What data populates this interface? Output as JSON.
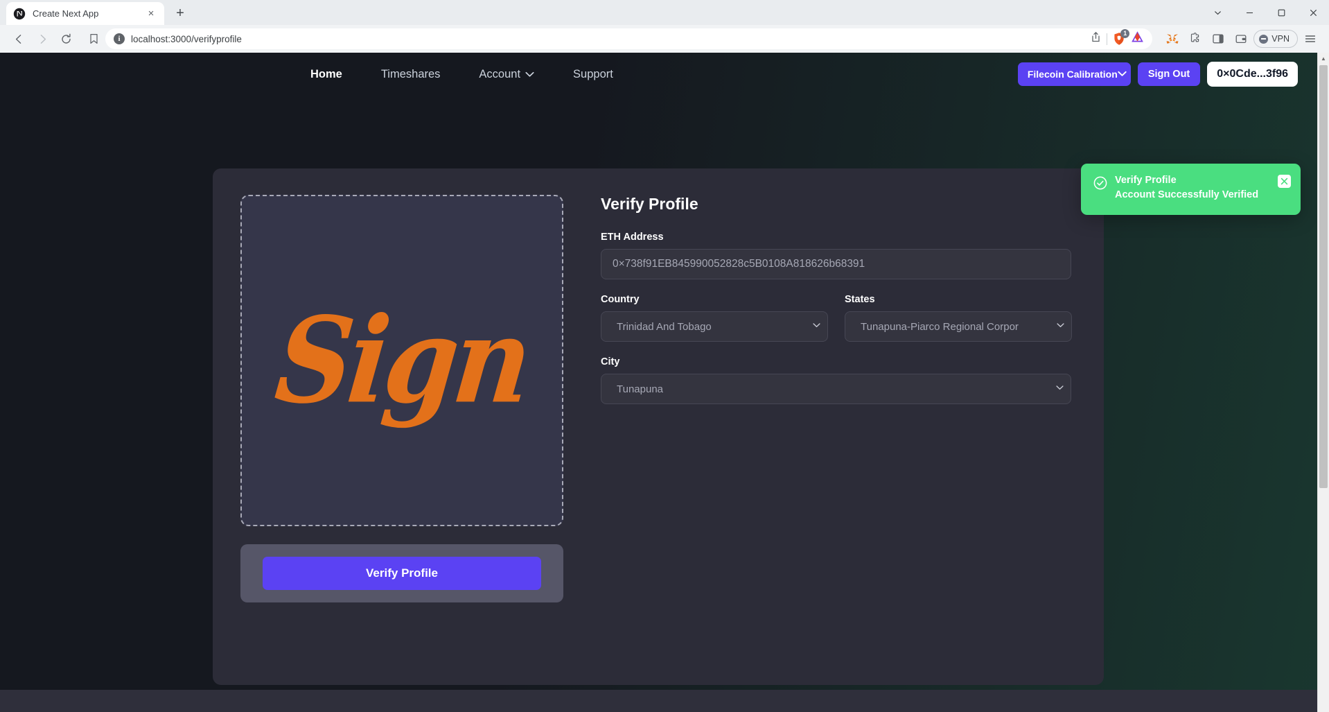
{
  "browser": {
    "tab": {
      "title": "Create Next App",
      "favicon": "nextjs-globe-icon",
      "close": "×"
    },
    "new_tab_label": "+",
    "window_controls": [
      "chevron-down-icon",
      "minimize-icon",
      "maximize-icon",
      "close-icon"
    ],
    "nav": {
      "back": "back-icon",
      "forward": "forward-icon",
      "reload": "reload-icon",
      "bookmark": "bookmark-icon"
    },
    "omnibox": {
      "site_info": "i",
      "url": "localhost:3000/verifyprofile",
      "share_icon": "share-icon",
      "brave_shield_count": "1"
    },
    "extensions": {
      "metamask": "metamask-fox-icon",
      "puzzle": "extensions-puzzle-icon",
      "sidebar": "sidebar-panel-icon",
      "wallet": "brave-wallet-icon",
      "vpn_label": "VPN",
      "menu": "hamburger-menu-icon"
    }
  },
  "site": {
    "nav_links": [
      {
        "label": "Home",
        "active": true,
        "caret": false
      },
      {
        "label": "Timeshares",
        "active": false,
        "caret": false
      },
      {
        "label": "Account",
        "active": false,
        "caret": true
      },
      {
        "label": "Support",
        "active": false,
        "caret": false
      }
    ],
    "network": {
      "label": "Filecoin Calibration",
      "caret": "chevron-down-icon"
    },
    "sign_out_label": "Sign Out",
    "account_address": "0×0Cde...3f96"
  },
  "toast": {
    "icon": "check-circle-icon",
    "title": "Verify Profile",
    "message": "Account Successfully Verified",
    "close": "×",
    "color": "#4ade80"
  },
  "signature_pad": {
    "drawn_text": "Sign",
    "ink_color": "#e3711a"
  },
  "verify_button_label": "Verify Profile",
  "form": {
    "title": "Verify Profile",
    "eth_address": {
      "label": "ETH Address",
      "value": "0×738f91EB845990052828c5B0108A818626b68391"
    },
    "country": {
      "label": "Country",
      "value": "Trinidad And Tobago"
    },
    "states": {
      "label": "States",
      "value": "Tunapuna-Piarco Regional Corpor"
    },
    "city": {
      "label": "City",
      "value": "Tunapuna"
    }
  },
  "colors": {
    "accent": "#5b42f3",
    "success": "#4ade80",
    "page_bg": "#15181f",
    "card_bg": "#2c2c38"
  }
}
